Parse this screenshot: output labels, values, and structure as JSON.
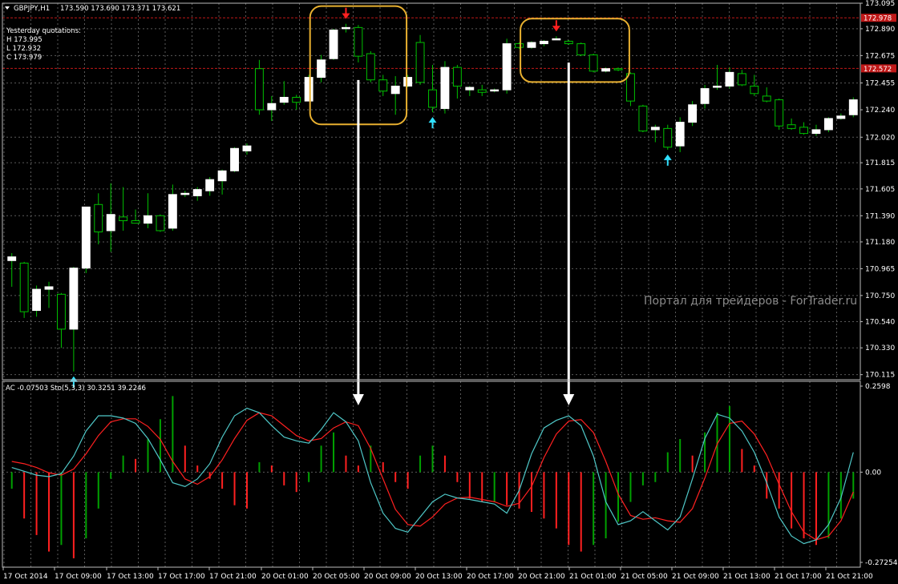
{
  "header": {
    "symbol": "GBPJPY,H1",
    "ohlc_text": "173.590 173.690 173.371 173.621",
    "yesterday_title": "Yesterday quotations:",
    "yesterday_high": "H 173.995",
    "yesterday_low": "L 172.932",
    "yesterday_close": "C 173.979"
  },
  "watermark": "Портал для трейдеров - ForTrader.ru",
  "indicator_header": "AC -0.07503  Sto(5,3,3) 30.3251 39.2246",
  "colors": {
    "background": "#000000",
    "grid": "#5a5a5a",
    "bull_candle": "#ffffff",
    "bear_candle": "#000000",
    "wick": "#00c000",
    "ac_up": "#00a000",
    "ac_down": "#ff2020",
    "stoch_main": "#4fc8c8",
    "stoch_signal": "#ff2020",
    "level_line": "#c01818",
    "highlight_box": "#e8b030",
    "arrow_down": "#ff2020",
    "arrow_up": "#30e0ff",
    "pointer": "#ffffff"
  },
  "chart_data": [
    {
      "type": "candlestick",
      "symbol": "GBPJPY",
      "timeframe": "H1",
      "ylim": [
        170.1,
        173.095
      ],
      "y_ticks": [
        "173.095",
        "172.890",
        "172.675",
        "172.455",
        "172.240",
        "172.020",
        "171.815",
        "171.605",
        "171.390",
        "171.180",
        "170.965",
        "170.750",
        "170.540",
        "170.330",
        "170.115"
      ],
      "price_tags": [
        {
          "label": "172.978",
          "value": 172.978,
          "style": "line"
        },
        {
          "label": "172.572",
          "value": 172.572,
          "style": "line"
        }
      ],
      "x_ticks": [
        "17 Oct 2014",
        "17 Oct 09:00",
        "17 Oct 13:00",
        "17 Oct 17:00",
        "17 Oct 21:00",
        "20 Oct 01:00",
        "20 Oct 05:00",
        "20 Oct 09:00",
        "20 Oct 13:00",
        "20 Oct 17:00",
        "20 Oct 21:00",
        "21 Oct 01:00",
        "21 Oct 05:00",
        "21 Oct 09:00",
        "21 Oct 13:00",
        "21 Oct 17:00",
        "21 Oct 21:00"
      ],
      "candles": [
        [
          171.03,
          171.09,
          170.82,
          171.06
        ],
        [
          171.01,
          171.02,
          170.57,
          170.62
        ],
        [
          170.63,
          170.83,
          170.58,
          170.8
        ],
        [
          170.8,
          170.86,
          170.65,
          170.82
        ],
        [
          170.76,
          170.77,
          170.33,
          170.48
        ],
        [
          170.48,
          170.98,
          170.14,
          170.97
        ],
        [
          170.97,
          171.42,
          170.93,
          171.46
        ],
        [
          171.48,
          171.57,
          171.16,
          171.26
        ],
        [
          171.27,
          171.65,
          171.1,
          171.4
        ],
        [
          171.38,
          171.62,
          171.27,
          171.35
        ],
        [
          171.35,
          171.44,
          171.33,
          171.33
        ],
        [
          171.33,
          171.57,
          171.29,
          171.39
        ],
        [
          171.39,
          171.4,
          171.26,
          171.27
        ],
        [
          171.29,
          171.64,
          171.27,
          171.56
        ],
        [
          171.56,
          171.59,
          171.54,
          171.57
        ],
        [
          171.55,
          171.62,
          171.51,
          171.6
        ],
        [
          171.59,
          171.7,
          171.55,
          171.68
        ],
        [
          171.67,
          171.76,
          171.56,
          171.75
        ],
        [
          171.75,
          171.94,
          171.74,
          171.93
        ],
        [
          171.91,
          171.97,
          171.88,
          171.95
        ],
        [
          172.57,
          172.64,
          172.2,
          172.24
        ],
        [
          172.24,
          172.35,
          172.15,
          172.29
        ],
        [
          172.3,
          172.47,
          172.28,
          172.34
        ],
        [
          172.34,
          172.36,
          172.24,
          172.3
        ],
        [
          172.31,
          172.52,
          172.31,
          172.5
        ],
        [
          172.5,
          172.68,
          172.46,
          172.64
        ],
        [
          172.65,
          172.89,
          172.64,
          172.88
        ],
        [
          172.9,
          172.93,
          172.86,
          172.9
        ],
        [
          172.9,
          172.92,
          172.62,
          172.67
        ],
        [
          172.69,
          172.71,
          172.46,
          172.48
        ],
        [
          172.48,
          172.52,
          172.35,
          172.39
        ],
        [
          172.37,
          172.51,
          172.2,
          172.43
        ],
        [
          172.43,
          172.52,
          172.42,
          172.5
        ],
        [
          172.78,
          172.84,
          172.44,
          172.46
        ],
        [
          172.4,
          172.6,
          172.22,
          172.26
        ],
        [
          172.25,
          172.63,
          172.21,
          172.58
        ],
        [
          172.58,
          172.6,
          172.33,
          172.43
        ],
        [
          172.4,
          172.43,
          172.35,
          172.42
        ],
        [
          172.4,
          172.44,
          172.35,
          172.38
        ],
        [
          172.4,
          172.41,
          172.38,
          172.4
        ],
        [
          172.4,
          172.81,
          172.37,
          172.77
        ],
        [
          172.77,
          172.78,
          172.73,
          172.74
        ],
        [
          172.74,
          172.79,
          172.73,
          172.78
        ],
        [
          172.77,
          172.8,
          172.75,
          172.79
        ],
        [
          172.81,
          172.83,
          172.8,
          172.81
        ],
        [
          172.79,
          172.8,
          172.76,
          172.77
        ],
        [
          172.77,
          172.78,
          172.67,
          172.68
        ],
        [
          172.68,
          172.69,
          172.54,
          172.55
        ],
        [
          172.55,
          172.58,
          172.54,
          172.57
        ],
        [
          172.57,
          172.58,
          172.55,
          172.56
        ],
        [
          172.53,
          172.54,
          172.27,
          172.31
        ],
        [
          172.27,
          172.28,
          172.06,
          172.07
        ],
        [
          172.08,
          172.12,
          171.98,
          172.1
        ],
        [
          172.09,
          172.12,
          171.92,
          171.94
        ],
        [
          171.95,
          172.18,
          171.9,
          172.14
        ],
        [
          172.14,
          172.31,
          172.11,
          172.28
        ],
        [
          172.29,
          172.44,
          172.25,
          172.41
        ],
        [
          172.42,
          172.6,
          172.4,
          172.43
        ],
        [
          172.43,
          172.58,
          172.41,
          172.54
        ],
        [
          172.53,
          172.56,
          172.43,
          172.44
        ],
        [
          172.43,
          172.52,
          172.35,
          172.37
        ],
        [
          172.35,
          172.42,
          172.3,
          172.31
        ],
        [
          172.32,
          172.33,
          172.08,
          172.11
        ],
        [
          172.12,
          172.17,
          172.08,
          172.09
        ],
        [
          172.1,
          172.14,
          172.04,
          172.05
        ],
        [
          172.05,
          172.12,
          172.03,
          172.08
        ],
        [
          172.08,
          172.18,
          172.06,
          172.17
        ],
        [
          172.17,
          172.21,
          172.16,
          172.19
        ],
        [
          172.2,
          172.34,
          172.18,
          172.32
        ]
      ],
      "signals": [
        {
          "type": "up",
          "index": 5,
          "color": "#30e0ff"
        },
        {
          "type": "down",
          "index": 27,
          "color": "#ff2020"
        },
        {
          "type": "up",
          "index": 34,
          "color": "#30e0ff"
        },
        {
          "type": "down",
          "index": 44,
          "color": "#ff2020"
        },
        {
          "type": "up",
          "index": 53,
          "color": "#30e0ff"
        }
      ],
      "highlight_ranges": [
        [
          25,
          31
        ],
        [
          42,
          49
        ]
      ]
    },
    {
      "type": "indicator",
      "name": "Accelerator Oscillator (histogram) + Stochastic(5,3,3)",
      "ac_ylim": [
        -0.27254,
        0.2598
      ],
      "y_ticks": [
        "0.2598",
        "0.00",
        "-0.27254"
      ],
      "ac_values": [
        -0.05,
        -0.14,
        -0.19,
        -0.24,
        -0.22,
        -0.26,
        -0.2,
        -0.11,
        -0.02,
        0.05,
        0.04,
        0.1,
        0.16,
        0.23,
        0.08,
        0.02,
        -0.02,
        -0.05,
        -0.1,
        -0.11,
        0.03,
        0.02,
        -0.04,
        -0.06,
        -0.03,
        0.08,
        0.12,
        0.05,
        0.02,
        0.08,
        0.03,
        -0.03,
        -0.05,
        0.05,
        0.08,
        0.05,
        -0.03,
        -0.08,
        -0.09,
        -0.09,
        -0.1,
        -0.11,
        -0.12,
        -0.14,
        -0.17,
        -0.22,
        -0.24,
        -0.22,
        -0.2,
        -0.15,
        -0.09,
        -0.04,
        -0.03,
        0.06,
        0.1,
        0.05,
        0.12,
        0.18,
        0.2,
        0.07,
        0.02,
        -0.08,
        -0.11,
        -0.17,
        -0.2,
        -0.22,
        -0.2,
        -0.14,
        -0.08
      ],
      "stoch_main": [
        20,
        15,
        10,
        8,
        12,
        35,
        68,
        88,
        88,
        85,
        78,
        58,
        30,
        0,
        -5,
        5,
        25,
        60,
        88,
        98,
        92,
        75,
        60,
        55,
        52,
        70,
        92,
        80,
        55,
        0,
        -40,
        -60,
        -65,
        -45,
        -25,
        -15,
        -20,
        -22,
        -25,
        -28,
        -40,
        -10,
        38,
        72,
        82,
        88,
        75,
        35,
        -25,
        -55,
        -50,
        -38,
        -50,
        -62,
        -45,
        5,
        58,
        90,
        85,
        68,
        40,
        0,
        -45,
        -70,
        -80,
        -75,
        -55,
        -20,
        40
      ],
      "stoch_signal": [
        28,
        25,
        20,
        13,
        10,
        18,
        38,
        62,
        80,
        84,
        84,
        74,
        57,
        28,
        5,
        -2,
        8,
        30,
        58,
        82,
        92,
        88,
        75,
        62,
        55,
        58,
        72,
        80,
        75,
        45,
        5,
        -35,
        -55,
        -57,
        -45,
        -28,
        -20,
        -19,
        -22,
        -25,
        -31,
        -27,
        -5,
        33,
        64,
        81,
        83,
        66,
        28,
        -15,
        -43,
        -48,
        -46,
        -50,
        -52,
        -34,
        6,
        51,
        78,
        81,
        64,
        36,
        -2,
        -38,
        -65,
        -75,
        -70,
        -50,
        -12
      ]
    }
  ]
}
